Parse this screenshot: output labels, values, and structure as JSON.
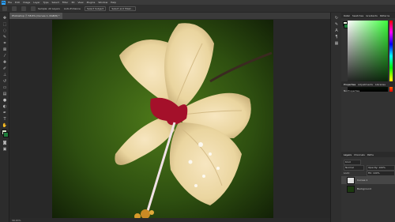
{
  "menubar": {
    "items": [
      "File",
      "Edit",
      "Image",
      "Layer",
      "Type",
      "Select",
      "Filter",
      "3D",
      "View",
      "Plugins",
      "Window",
      "Help"
    ]
  },
  "optbar": {
    "sample_label": "Sample: All Layers",
    "auto_enhance": "Auto-Enhance",
    "select_subject": "Select Subject",
    "select_mask": "Select and Mask..."
  },
  "document": {
    "tab_title": "Photoshop ⓔ 58.6% (Curves 1, RGB/8) *"
  },
  "status": {
    "zoom": "58.63%"
  },
  "panels": {
    "color_tabs": [
      "Color",
      "Swatches",
      "Gradients",
      "Patterns"
    ],
    "properties_tabs": [
      "Properties",
      "Adjustments",
      "Libraries"
    ],
    "properties_label": "No Properties",
    "layers_tabs": [
      "Layers",
      "Channels",
      "Paths"
    ],
    "kind_label": "Kind",
    "blend_mode": "Normal",
    "opacity_label": "Opacity: 100%",
    "lock_label": "Lock:",
    "fill_label": "Fill: 100%",
    "layers": [
      {
        "name": "Curves 1"
      },
      {
        "name": "Background"
      }
    ]
  },
  "colors": {
    "foreground": "#d9e8d0",
    "background": "#1d7d3a",
    "accent": "#31a8ff"
  }
}
